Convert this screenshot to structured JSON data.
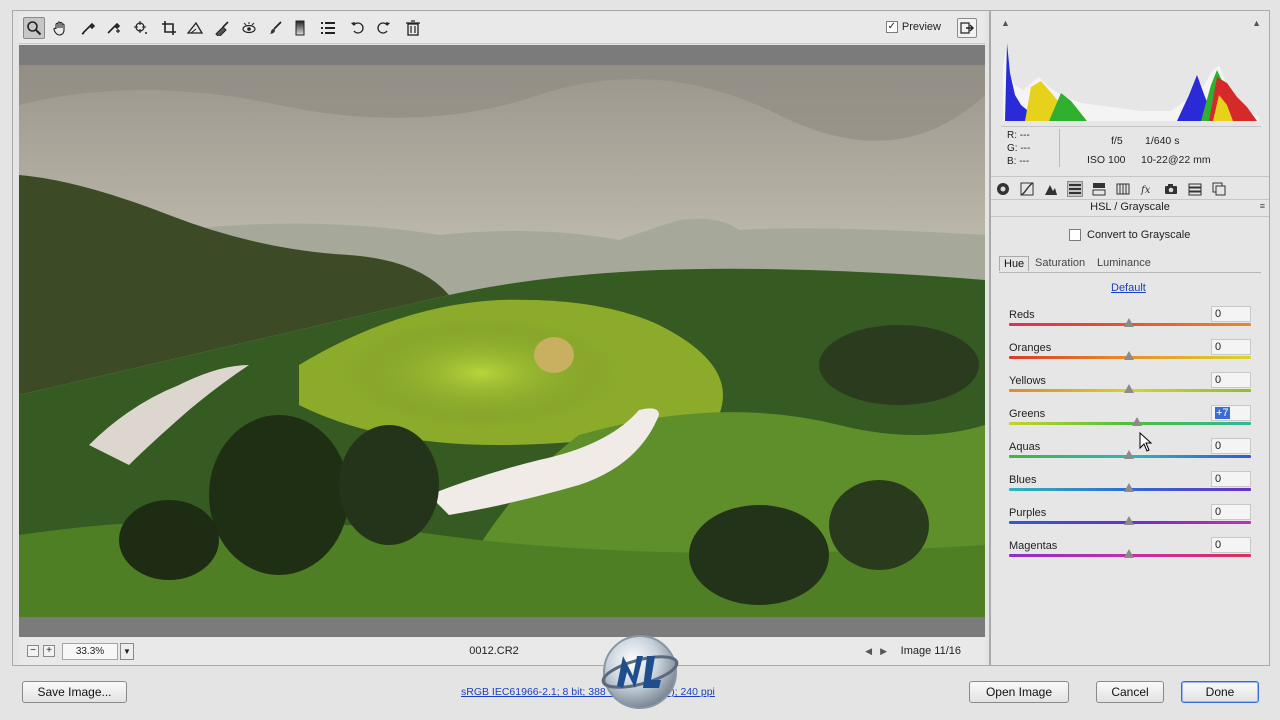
{
  "toolbar": {
    "tools": [
      "zoom-tool",
      "hand-tool",
      "white-balance-tool",
      "color-sampler-tool",
      "target-adjustment-tool",
      "crop-tool",
      "straighten-tool",
      "spot-removal-tool",
      "red-eye-tool",
      "adjustment-brush",
      "graduated-filter",
      "preferences",
      "rotate-ccw",
      "rotate-cw",
      "trash"
    ],
    "preview_label": "Preview",
    "preview_checked": true
  },
  "status": {
    "zoom_value": "33.3%",
    "filename": "0012.CR2",
    "image_count": "Image 11/16"
  },
  "info": {
    "r": "R:  ---",
    "g": "G:  ---",
    "b": "B:  ---",
    "aperture": "f/5",
    "shutter": "1/640 s",
    "iso": "ISO 100",
    "lens": "10-22@22 mm"
  },
  "panel": {
    "title": "HSL / Grayscale",
    "convert_label": "Convert to Grayscale",
    "convert_checked": false,
    "tabs": [
      "Hue",
      "Saturation",
      "Luminance"
    ],
    "active_tab": "Hue",
    "default_label": "Default",
    "sliders": [
      {
        "label": "Reds",
        "value": "0",
        "pos": 0.5
      },
      {
        "label": "Oranges",
        "value": "0",
        "pos": 0.5
      },
      {
        "label": "Yellows",
        "value": "0",
        "pos": 0.5
      },
      {
        "label": "Greens",
        "value": "+7",
        "pos": 0.535,
        "highlighted": true
      },
      {
        "label": "Aquas",
        "value": "0",
        "pos": 0.5
      },
      {
        "label": "Blues",
        "value": "0",
        "pos": 0.5
      },
      {
        "label": "Purples",
        "value": "0",
        "pos": 0.5
      },
      {
        "label": "Magentas",
        "value": "0",
        "pos": 0.5
      }
    ]
  },
  "footer": {
    "save_label": "Save Image...",
    "workflow_link": "sRGB IEC61966-2.1; 8 bit; 388   v 1654 (   4MP); 240 ppi",
    "open_label": "Open Image",
    "cancel_label": "Cancel",
    "done_label": "Done"
  },
  "colors": {
    "accent": "#3a6cd6",
    "link": "#1a3fc0"
  }
}
